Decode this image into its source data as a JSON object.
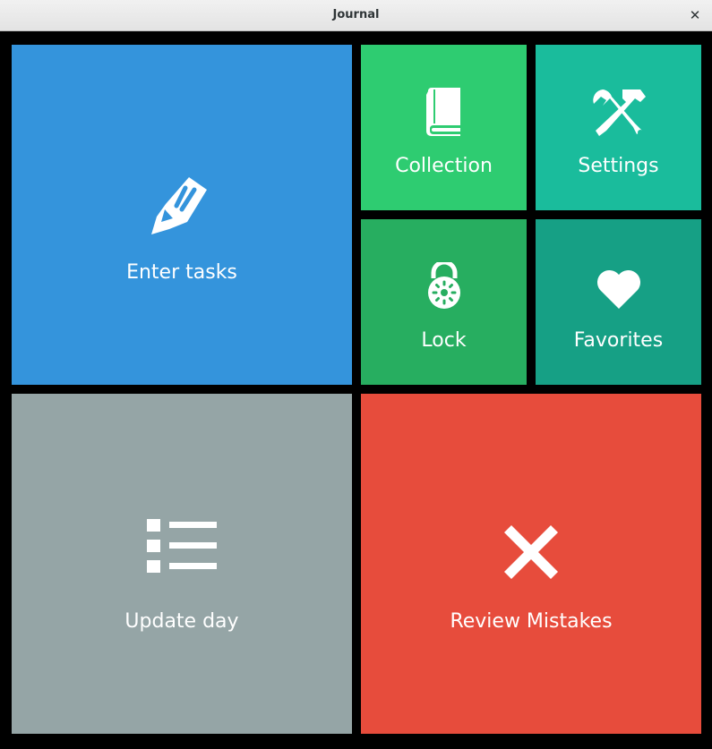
{
  "window": {
    "title": "Journal",
    "close_glyph": "✕"
  },
  "tiles": [
    {
      "id": "enter-tasks",
      "label": "Enter tasks",
      "color": "#3494dc",
      "icon": "pencil-icon"
    },
    {
      "id": "collection",
      "label": "Collection",
      "color": "#2ecc71",
      "icon": "book-icon"
    },
    {
      "id": "settings",
      "label": "Settings",
      "color": "#1abc9c",
      "icon": "tools-icon"
    },
    {
      "id": "lock",
      "label": "Lock",
      "color": "#27ae60",
      "icon": "lock-icon"
    },
    {
      "id": "favorites",
      "label": "Favorites",
      "color": "#16a085",
      "icon": "heart-icon"
    },
    {
      "id": "update-day",
      "label": "Update day",
      "color": "#95a5a6",
      "icon": "list-icon"
    },
    {
      "id": "review-mistakes",
      "label": "Review Mistakes",
      "color": "#e74c3c",
      "icon": "x-mark-icon"
    }
  ]
}
